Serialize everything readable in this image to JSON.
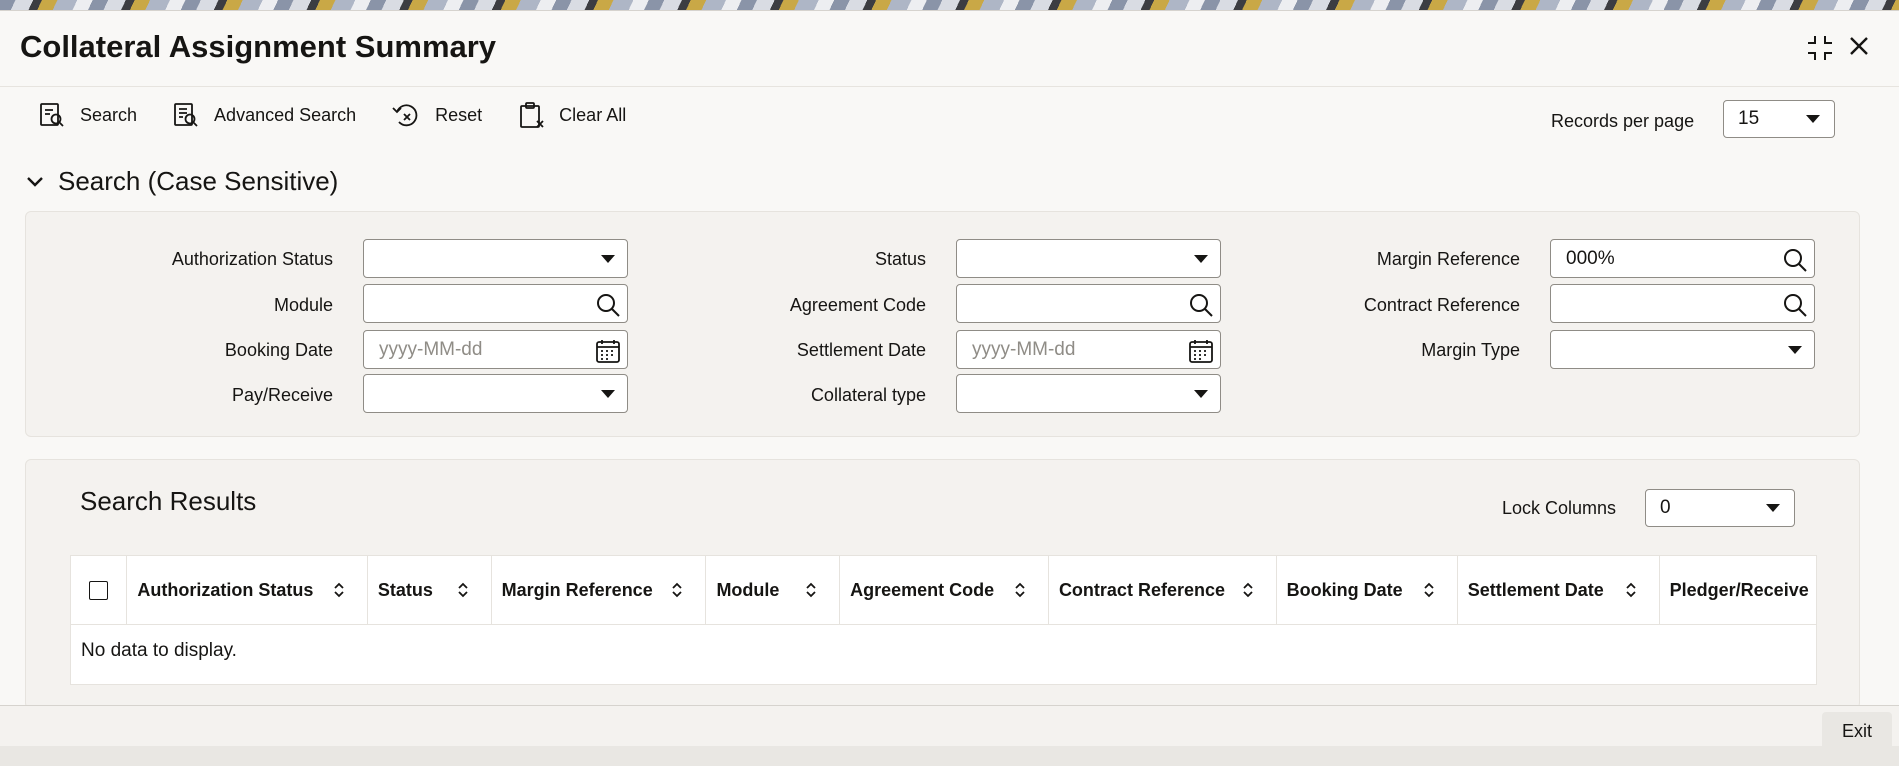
{
  "window": {
    "title": "Collateral Assignment Summary"
  },
  "toolbar": {
    "search": "Search",
    "advanced_search": "Advanced Search",
    "reset": "Reset",
    "clear_all": "Clear All",
    "records_per_page_label": "Records per page",
    "records_per_page_value": "15"
  },
  "search": {
    "section_title": "Search (Case Sensitive)",
    "fields": {
      "authorization_status": {
        "label": "Authorization Status",
        "value": ""
      },
      "status": {
        "label": "Status",
        "value": ""
      },
      "margin_reference": {
        "label": "Margin Reference",
        "value": "000%"
      },
      "module": {
        "label": "Module",
        "value": ""
      },
      "agreement_code": {
        "label": "Agreement Code",
        "value": ""
      },
      "contract_reference": {
        "label": "Contract Reference",
        "value": ""
      },
      "booking_date": {
        "label": "Booking Date",
        "placeholder": "yyyy-MM-dd"
      },
      "settlement_date": {
        "label": "Settlement Date",
        "placeholder": "yyyy-MM-dd"
      },
      "margin_type": {
        "label": "Margin Type",
        "value": ""
      },
      "pay_receive": {
        "label": "Pay/Receive",
        "value": ""
      },
      "collateral_type": {
        "label": "Collateral type",
        "value": ""
      }
    }
  },
  "results": {
    "title": "Search Results",
    "lock_columns_label": "Lock Columns",
    "lock_columns_value": "0",
    "columns": [
      "Authorization Status",
      "Status",
      "Margin Reference",
      "Module",
      "Agreement Code",
      "Contract Reference",
      "Booking Date",
      "Settlement Date",
      "Pledger/Receive"
    ],
    "empty_message": "No data to display."
  },
  "footer": {
    "exit": "Exit"
  },
  "icons": {
    "minimize": "collapse-icon",
    "close": "close-icon",
    "search": "search-doc-icon",
    "advanced_search": "advanced-search-icon",
    "reset": "reset-icon",
    "clear_all": "clipboard-icon",
    "chevron": "chevron-down-icon",
    "lookup": "magnifier-icon",
    "calendar": "calendar-icon",
    "sort": "sort-icon"
  }
}
